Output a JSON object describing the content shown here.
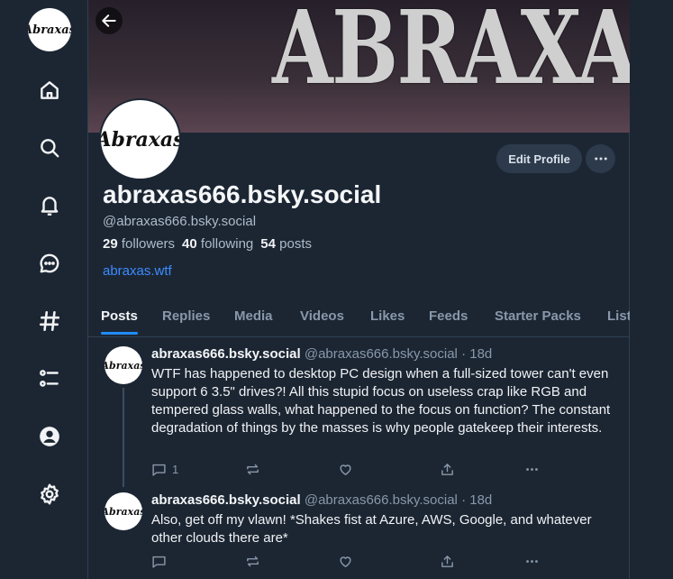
{
  "profile": {
    "banner_text": "ABRAXAS",
    "avatar_text": "Abraxas",
    "display_name": "abraxas666.bsky.social",
    "handle": "@abraxas666.bsky.social",
    "followers_count": "29",
    "followers_label": "followers",
    "following_count": "40",
    "following_label": "following",
    "posts_count": "54",
    "posts_label": "posts",
    "website": "abraxas.wtf",
    "edit_label": "Edit Profile"
  },
  "tabs": [
    "Posts",
    "Replies",
    "Media",
    "Videos",
    "Likes",
    "Feeds",
    "Starter Packs",
    "Lists"
  ],
  "posts": [
    {
      "name": "abraxas666.bsky.social",
      "handle": "@abraxas666.bsky.social",
      "time": "18d",
      "text": "WTF has happened to desktop PC design when a full-sized tower can't even support 6 3.5\" drives?!  All this stupid focus on useless crap like RGB and tempered glass walls, what happened to the focus on function? The constant degradation of things by the masses is why people gatekeep their interests.",
      "reply_count": "1"
    },
    {
      "name": "abraxas666.bsky.social",
      "handle": "@abraxas666.bsky.social",
      "time": "18d",
      "text": "Also, get off my vlawn!  *Shakes fist at Azure, AWS, Google, and whatever other clouds there are*",
      "reply_count": ""
    }
  ],
  "icons": [
    "home-icon",
    "search-icon",
    "bell-icon",
    "chat-icon",
    "hashtag-icon",
    "list-icon",
    "profile-icon",
    "settings-icon"
  ],
  "colors": {
    "background": "#1c2633",
    "accent": "#208bfe",
    "link": "#3b8cff",
    "muted": "#8898aa"
  }
}
